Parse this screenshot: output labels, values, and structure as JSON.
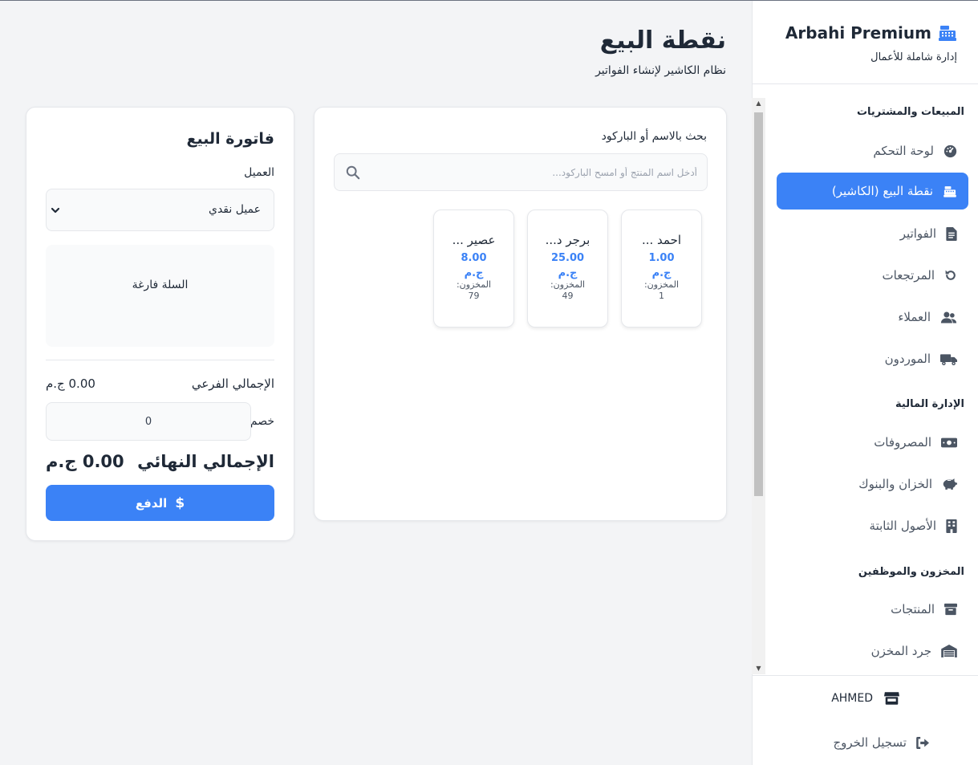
{
  "brand": {
    "title": "Arbahi Premium",
    "subtitle": "إدارة شاملة للأعمال",
    "icon": "cash-register-icon"
  },
  "sidebar": {
    "sections": [
      {
        "title": "المبيعات والمشتريات"
      },
      {
        "title": "الإدارة المالية"
      },
      {
        "title": "المخزون والموظفين"
      }
    ],
    "items": [
      {
        "label": "لوحة التحكم",
        "icon": "dashboard-gauge-icon"
      },
      {
        "label": "نقطة البيع (الكاشير)",
        "icon": "cash-register-icon",
        "active": true
      },
      {
        "label": "الفواتير",
        "icon": "invoice-file-icon"
      },
      {
        "label": "المرتجعات",
        "icon": "undo-icon"
      },
      {
        "label": "العملاء",
        "icon": "users-icon"
      },
      {
        "label": "الموردون",
        "icon": "truck-icon"
      },
      {
        "label": "المصروفات",
        "icon": "money-bill-icon"
      },
      {
        "label": "الخزان والبنوك",
        "icon": "piggy-bank-icon"
      },
      {
        "label": "الأصول الثابتة",
        "icon": "building-icon"
      },
      {
        "label": "المنتجات",
        "icon": "box-icon"
      },
      {
        "label": "جرد المخزن",
        "icon": "warehouse-icon"
      }
    ],
    "user": {
      "name": "AHMED",
      "icon": "store-icon"
    },
    "logout": {
      "label": "تسجيل الخروج",
      "icon": "sign-out-icon"
    }
  },
  "page": {
    "title": "نقطة البيع",
    "subtitle": "نظام الكاشير لإنشاء الفواتير"
  },
  "products_panel": {
    "search_label": "بحث بالاسم أو الباركود",
    "search_placeholder": "أدخل اسم المنتج أو امسح الباركود...",
    "search_value": "",
    "products": [
      {
        "name": "احمد ...",
        "price": "1.00",
        "currency": "ج.م",
        "stock_label": "المخزون:",
        "stock": "1"
      },
      {
        "name": "برجر د...",
        "price": "25.00",
        "currency": "ج.م",
        "stock_label": "المخزون:",
        "stock": "49"
      },
      {
        "name": "عصير ...",
        "price": "8.00",
        "currency": "ج.م",
        "stock_label": "المخزون:",
        "stock": "79"
      }
    ]
  },
  "invoice": {
    "title": "فاتورة البيع",
    "customer_label": "العميل",
    "customer_value": "عميل نقدي",
    "cart_empty": "السلة فارغة",
    "subtotal_label": "الإجمالي الفرعي",
    "subtotal_value": "0.00 ج.م",
    "discount_label": "خصم",
    "discount_value": "0",
    "total_label": "الإجمالي النهائي",
    "total_value": "0.00 ج.م",
    "pay_label": "الدفع"
  },
  "colors": {
    "accent": "#3b82f6",
    "sidebar_bg": "#ffffff",
    "page_bg": "#f3f4f6"
  }
}
